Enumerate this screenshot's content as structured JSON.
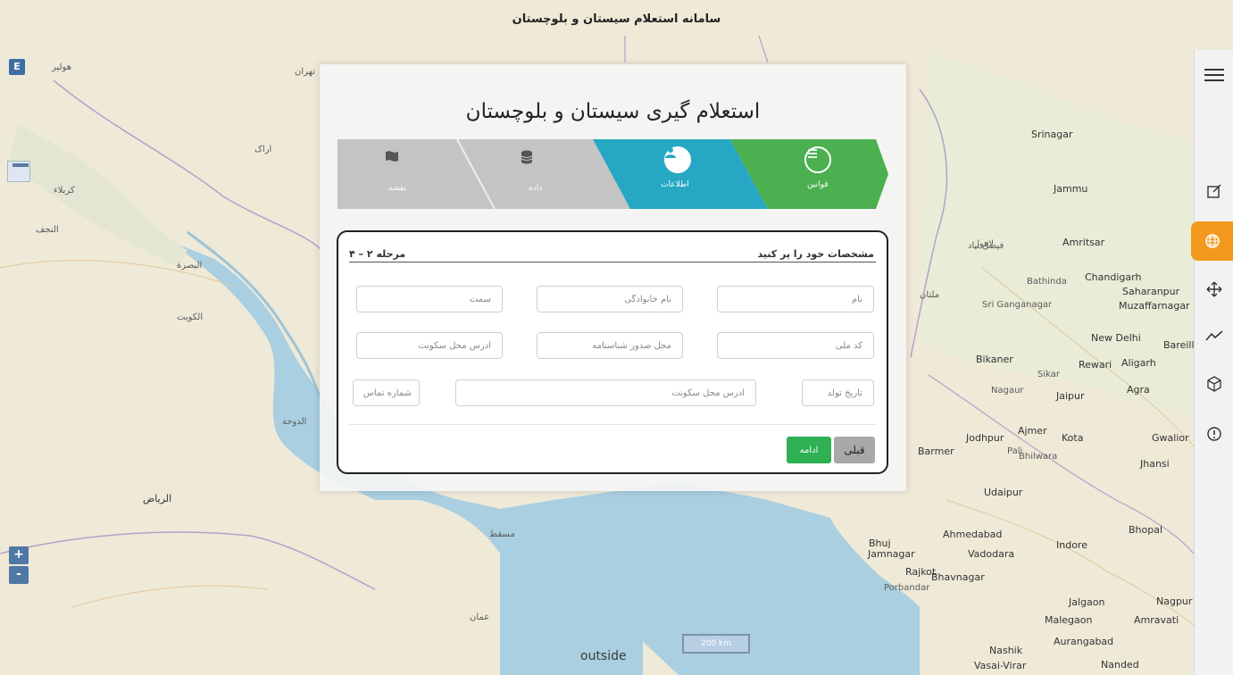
{
  "header": {
    "title": "سامانه استعلام سیستان و بلوچستان"
  },
  "map": {
    "e_button": "E",
    "zoom_in": "+",
    "zoom_out": "-",
    "scale_label": "200 km",
    "outside_label": "outside",
    "labels": [
      {
        "text": "Srinagar"
      },
      {
        "text": "Jammu"
      },
      {
        "text": "Amritsar"
      },
      {
        "text": "Chandigarh"
      },
      {
        "text": "Saharanpur"
      },
      {
        "text": "Muzaffarnagar"
      },
      {
        "text": "New Delhi"
      },
      {
        "text": "Bareilly"
      },
      {
        "text": "Aligarh"
      },
      {
        "text": "Rewari"
      },
      {
        "text": "Agra"
      },
      {
        "text": "Bikaner"
      },
      {
        "text": "Jaipur"
      },
      {
        "text": "Jodhpur"
      },
      {
        "text": "Ajmer"
      },
      {
        "text": "Kota"
      },
      {
        "text": "Gwalior"
      },
      {
        "text": "Jhansi"
      },
      {
        "text": "Udaipur"
      },
      {
        "text": "Ahmedabad"
      },
      {
        "text": "Bhopal"
      },
      {
        "text": "Indore"
      },
      {
        "text": "Vadodara"
      },
      {
        "text": "Rajkot"
      },
      {
        "text": "Bhavnagar"
      },
      {
        "text": "Jamnagar"
      },
      {
        "text": "Bhuj"
      },
      {
        "text": "Malegaon"
      },
      {
        "text": "Aurangabad"
      },
      {
        "text": "Nashik"
      },
      {
        "text": "Jalgaon"
      },
      {
        "text": "Amravati"
      },
      {
        "text": "Nagpur"
      },
      {
        "text": "Nanded"
      },
      {
        "text": "Barmer"
      },
      {
        "text": "Pali"
      },
      {
        "text": "Bhilwara"
      },
      {
        "text": "Nagaur"
      },
      {
        "text": "Sikar"
      },
      {
        "text": "Bathinda"
      },
      {
        "text": "Sri Ganganagar"
      },
      {
        "text": "Porbandar"
      },
      {
        "text": "Vasai-Virar"
      },
      {
        "text": "تهران"
      },
      {
        "text": "اراک"
      },
      {
        "text": "کربلاء"
      },
      {
        "text": "النجف"
      },
      {
        "text": "البصرة"
      },
      {
        "text": "الكويت"
      },
      {
        "text": "الرياض"
      },
      {
        "text": "الدوحة"
      },
      {
        "text": "عمان"
      },
      {
        "text": "مسقط"
      },
      {
        "text": "لاهور"
      },
      {
        "text": "ملتان"
      },
      {
        "text": "فیصل آباد"
      },
      {
        "text": "هولير"
      }
    ]
  },
  "toolbar": {
    "items": [
      {
        "icon": "menu-icon"
      },
      {
        "icon": "edit-icon"
      },
      {
        "icon": "globe-icon"
      },
      {
        "icon": "move-icon"
      },
      {
        "icon": "chart-line-icon"
      },
      {
        "icon": "cube-icon"
      },
      {
        "icon": "info-icon"
      }
    ],
    "active_color": "#f39a1e"
  },
  "panel": {
    "title": "استعلام گیری سیستان و بلوچستان",
    "steps": [
      {
        "label": "قوانین",
        "icon": "list-icon",
        "color": "#4caf50"
      },
      {
        "label": "اطلاعات",
        "icon": "user-icon",
        "color": "#26a7c4"
      },
      {
        "label": "داده",
        "icon": "database-icon",
        "color": "#c4c4c4"
      },
      {
        "label": "نقشه",
        "icon": "map-icon",
        "color": "#c4c4c4"
      }
    ]
  },
  "form": {
    "title": "مشخصات خود را پر کنید",
    "step_indicator": "مرحله ۲ – ۴",
    "fields": {
      "name": "نام",
      "family": "نام خانوادگی",
      "position": "سمت",
      "national_code": "کد ملی",
      "id_issue_place": "محل صدور شناسنامه",
      "address1": "آدرس محل سکونت",
      "birth_date": "تاریخ تولد",
      "address2": "آدرس محل سکونت",
      "phone": "شماره تماس"
    },
    "buttons": {
      "next": "ادامه",
      "prev": "قبلی"
    }
  }
}
